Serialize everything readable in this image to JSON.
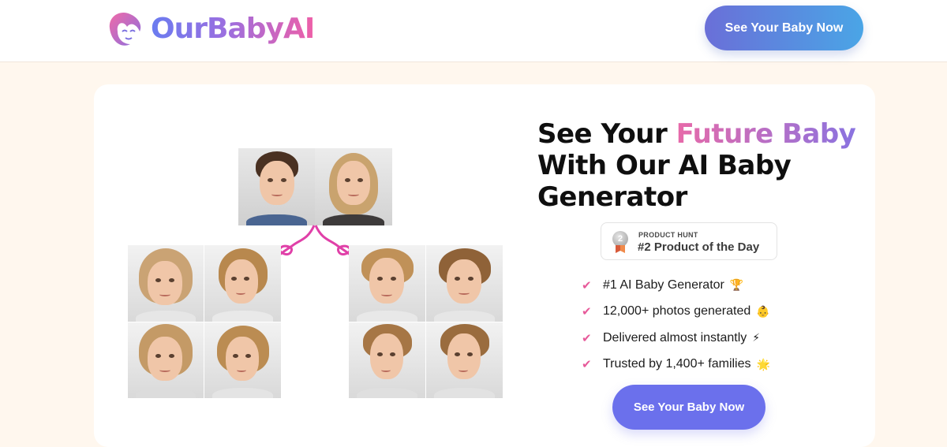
{
  "header": {
    "logo_text": "OurBabyAI",
    "cta_label": "See Your Baby Now"
  },
  "hero": {
    "headline_prefix": "See Your ",
    "headline_highlight": "Future Baby",
    "headline_suffix": "With Our AI Baby Generator",
    "badge": {
      "kicker": "PRODUCT HUNT",
      "title": "#2 Product of the Day",
      "medal_number": "2"
    },
    "features": [
      {
        "text": "#1 AI Baby Generator",
        "emoji": "🏆"
      },
      {
        "text": "12,000+ photos generated",
        "emoji": "👶"
      },
      {
        "text": "Delivered almost instantly",
        "emoji": "⚡"
      },
      {
        "text": "Trusted by 1,400+ families",
        "emoji": "🌟"
      }
    ],
    "cta_label": "See Your Baby Now"
  },
  "colors": {
    "brand_gradient_start": "#6a7cf0",
    "brand_gradient_end": "#ee5fa8",
    "accent_pink": "#e75a9a",
    "button_purple": "#6b70ec",
    "page_background": "#fff7ee"
  }
}
